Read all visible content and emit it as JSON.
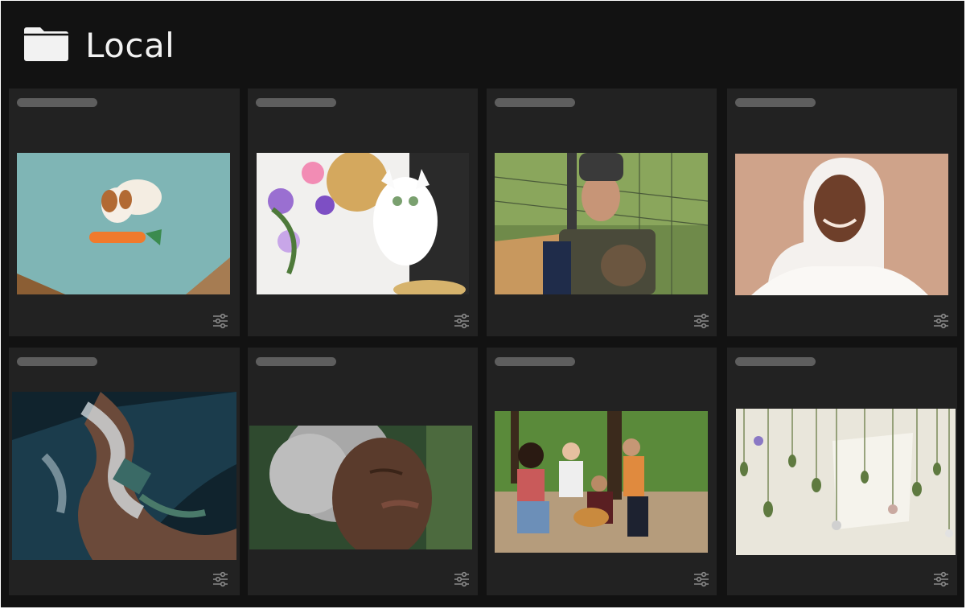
{
  "header": {
    "title": "Local",
    "icon": "folder-icon"
  },
  "theme": {
    "background": "#121212",
    "card": "#222222",
    "placeholder": "#5e5e5e",
    "icon": "#8a8a8a",
    "title_text": "#f2f2f2"
  },
  "cards": [
    {
      "photo_subject": "dog-on-blanket",
      "action_icon": "sliders-icon"
    },
    {
      "photo_subject": "white-cat-with-flowers",
      "action_icon": "sliders-icon"
    },
    {
      "photo_subject": "baseball-catcher",
      "action_icon": "sliders-icon"
    },
    {
      "photo_subject": "woman-in-hijab",
      "action_icon": "sliders-icon"
    },
    {
      "photo_subject": "aerial-coastline",
      "action_icon": "sliders-icon"
    },
    {
      "photo_subject": "elderly-woman",
      "action_icon": "sliders-icon"
    },
    {
      "photo_subject": "friends-with-guitar",
      "action_icon": "sliders-icon"
    },
    {
      "photo_subject": "hanging-dried-flowers",
      "action_icon": "sliders-icon"
    }
  ]
}
